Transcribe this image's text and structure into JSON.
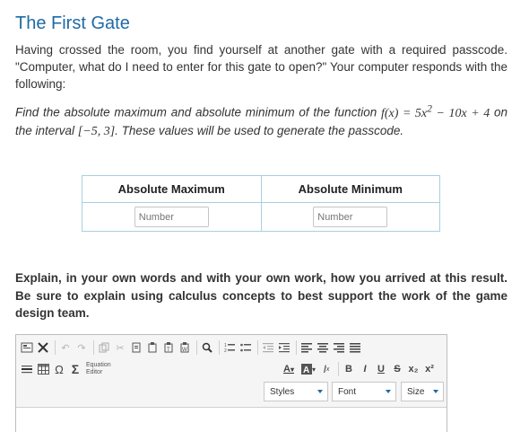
{
  "title": "The First Gate",
  "intro": "Having crossed the room, you find yourself at another gate with a required passcode. \"Computer, what do I need to enter for this gate to open?\" Your computer responds with the following:",
  "task": {
    "before": "Find the absolute maximum and absolute minimum of the function ",
    "func": "f(x) = 5x",
    "exp": "2",
    "func_rest": " − 10x + 4",
    "mid": " on the interval ",
    "interval": "[−5, 3]",
    "after": ". These values will be used to generate the passcode."
  },
  "table": {
    "col1": "Absolute Maximum",
    "col2": "Absolute Minimum",
    "placeholder1": "Number",
    "placeholder2": "Number"
  },
  "explain": "Explain, in your own words and with your own work, how you arrived at this result. Be sure to explain using calculus concepts to best support the work of the game design team.",
  "editor": {
    "equation_label": "Equation Editor",
    "styles_label": "Styles",
    "font_label": "Font",
    "size_label": "Size",
    "omega": "Ω",
    "sigma": "Σ",
    "bold": "B",
    "italic": "I",
    "underline": "U",
    "strike": "S",
    "sub": "x₂",
    "sup": "x²"
  }
}
